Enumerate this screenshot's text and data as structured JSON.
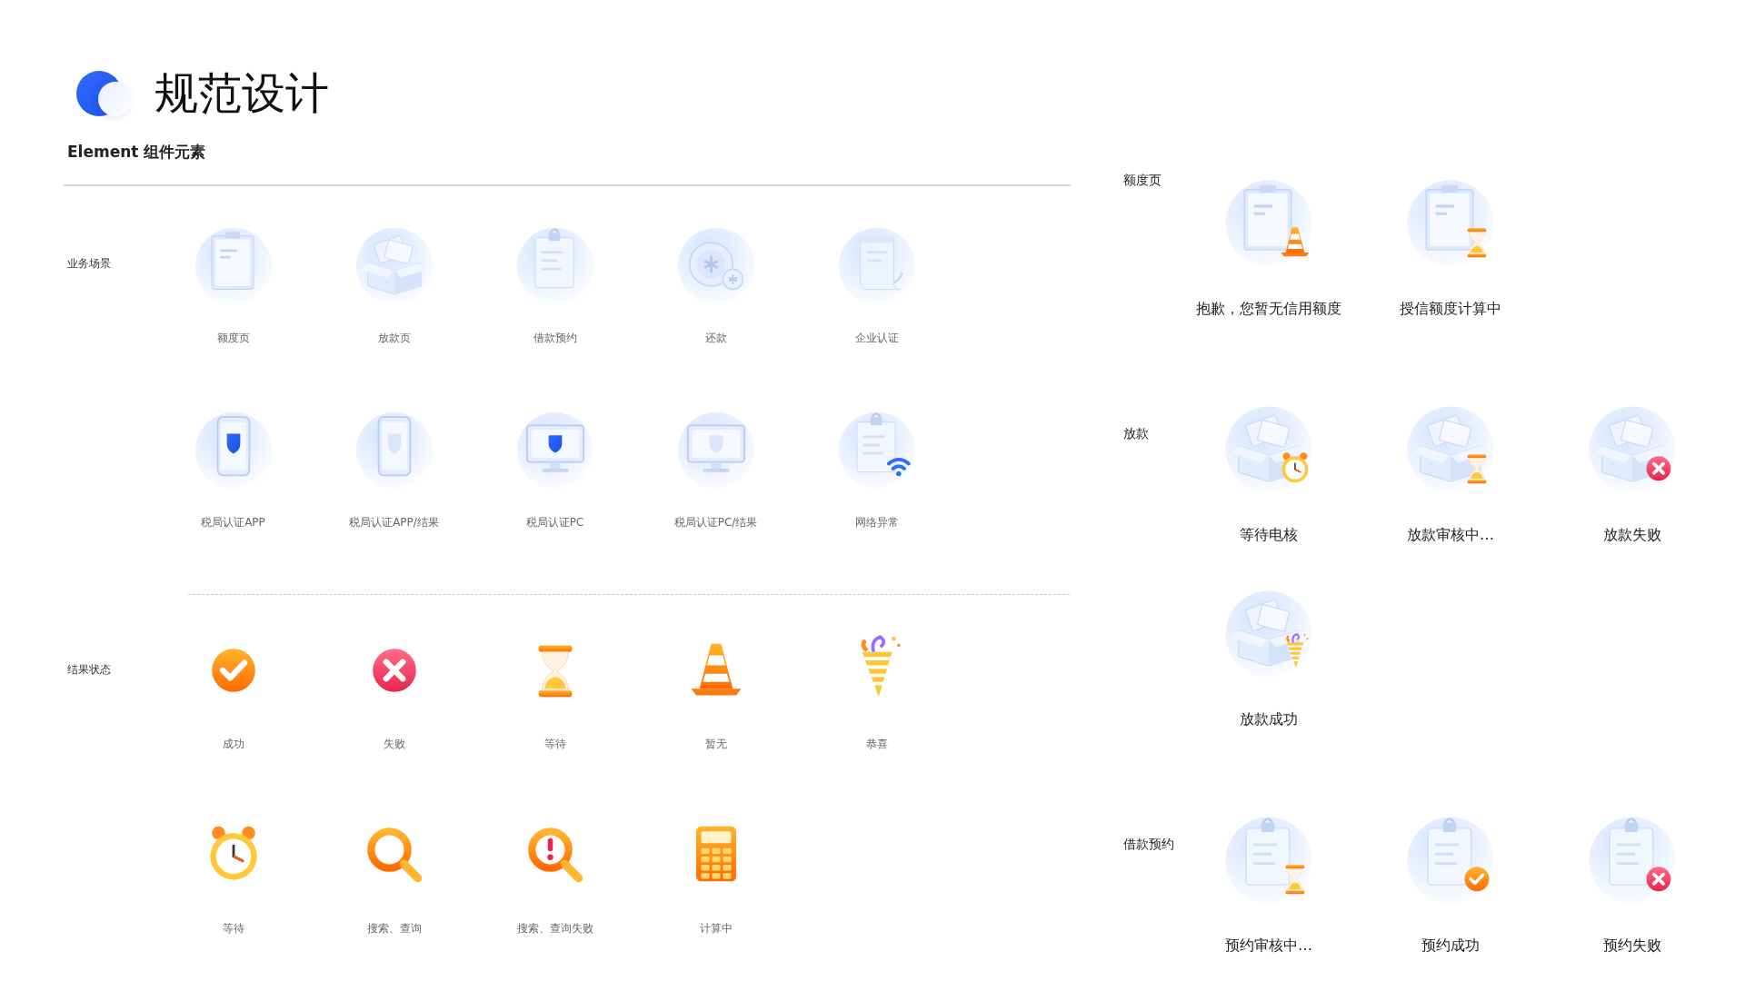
{
  "header": {
    "title": "规范设计",
    "subtitle": "Element 组件元素"
  },
  "left_sections": [
    {
      "label": "业务场景",
      "items": [
        {
          "label": "额度页",
          "kind": "clipboard"
        },
        {
          "label": "放款页",
          "kind": "box"
        },
        {
          "label": "借款预约",
          "kind": "doc"
        },
        {
          "label": "还款",
          "kind": "coins"
        },
        {
          "label": "企业认证",
          "kind": "scroll"
        },
        {
          "label": "税局认证APP",
          "kind": "phone"
        },
        {
          "label": "税局认证APP/结果",
          "kind": "phone-faint"
        },
        {
          "label": "税局认证PC",
          "kind": "monitor"
        },
        {
          "label": "税局认证PC/结果",
          "kind": "monitor-faint"
        },
        {
          "label": "网络异常",
          "kind": "doc",
          "badge": {
            "kind": "wifi"
          }
        }
      ]
    },
    {
      "label": "结果状态",
      "items": [
        {
          "label": "成功",
          "kind": "check"
        },
        {
          "label": "失败",
          "kind": "cross"
        },
        {
          "label": "等待",
          "kind": "hourglass"
        },
        {
          "label": "暂无",
          "kind": "cone"
        },
        {
          "label": "恭喜",
          "kind": "party"
        },
        {
          "label": "等待",
          "kind": "clock"
        },
        {
          "label": "搜索、查询",
          "kind": "search"
        },
        {
          "label": "搜索、查询失败",
          "kind": "search-alert"
        },
        {
          "label": "计算中",
          "kind": "calculator"
        }
      ]
    }
  ],
  "right_sections": [
    {
      "label": "额度页",
      "rows": [
        [
          {
            "label": "抱歉，您暂无信用额度",
            "kind": "clipboard",
            "badge": {
              "kind": "cone"
            }
          },
          {
            "label": "授信额度计算中",
            "kind": "clipboard",
            "badge": {
              "kind": "hourglass"
            }
          }
        ]
      ]
    },
    {
      "label": "放款",
      "rows": [
        [
          {
            "label": "等待电核",
            "kind": "box",
            "badge": {
              "kind": "clock"
            }
          },
          {
            "label": "放款审核中…",
            "kind": "box",
            "badge": {
              "kind": "hourglass"
            }
          },
          {
            "label": "放款失败",
            "kind": "box",
            "badge": {
              "kind": "cross"
            }
          }
        ],
        [
          {
            "label": "放款成功",
            "kind": "box",
            "badge": {
              "kind": "party"
            }
          }
        ]
      ]
    },
    {
      "label": "借款预约",
      "rows": [
        [
          {
            "label": "预约审核中…",
            "kind": "doc",
            "badge": {
              "kind": "hourglass"
            }
          },
          {
            "label": "预约成功",
            "kind": "doc",
            "badge": {
              "kind": "check"
            }
          },
          {
            "label": "预约失败",
            "kind": "doc",
            "badge": {
              "kind": "cross"
            }
          }
        ]
      ]
    }
  ]
}
